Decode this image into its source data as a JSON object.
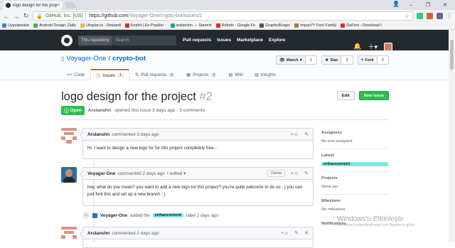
{
  "browser": {
    "tab_title": "logo design for the proje",
    "security_label": "GitHub, Inc. [US]",
    "url_host": "https://github.com",
    "url_path": "/Voyager-One/crypto-bot/issues/2",
    "bookmarks": [
      "Uygulamalar",
      "Android Design, Daily",
      "Utopian.io - Rewardi",
      "Keşfet | En Popüler -",
      "arslanshn — Steemit",
      "Roboto - Google Fo",
      "GraphicBurger",
      "Impact™ Font Family",
      "DaFont - Download f"
    ],
    "bookmark_colors": [
      "#4a7fd4",
      "#4caf50",
      "#e8b84a",
      "#d93025",
      "#1aa3a3",
      "#d93025",
      "#555555",
      "#9c7a52",
      "#d93025"
    ]
  },
  "github": {
    "search_scope": "This repository",
    "search_placeholder": "Search",
    "nav": [
      "Pull requests",
      "Issues",
      "Marketplace",
      "Explore"
    ],
    "icons": [
      "bell-icon",
      "plus-icon"
    ]
  },
  "repo": {
    "owner": "Voyager-One",
    "slash": "/",
    "name": "crypto-bot",
    "watch_label": "Watch",
    "watch_count": "1",
    "star_label": "Star",
    "star_count": "2",
    "fork_label": "Fork",
    "fork_count": "2",
    "tabs": [
      {
        "label": "Code",
        "count": ""
      },
      {
        "label": "Issues",
        "count": "1"
      },
      {
        "label": "Pull requests",
        "count": "0"
      },
      {
        "label": "Projects",
        "count": "0"
      },
      {
        "label": "Wiki",
        "count": ""
      },
      {
        "label": "Insights",
        "count": ""
      }
    ]
  },
  "issue": {
    "title": "logo design for the project",
    "number": "#2",
    "edit_label": "Edit",
    "new_issue_label": "New issue",
    "state": "Open",
    "author": "Arslanshn",
    "meta_text": "opened this issue 3 days ago · 3 comments"
  },
  "comments": [
    {
      "author": "Arslanshn",
      "when": "commented 3 days ago",
      "edited": "",
      "badge": "",
      "body": "Hi. I want to design a new logo for for this project completely free..."
    },
    {
      "author": "Voyager-One",
      "when": "commented 2 days ago",
      "edited": "• edited ▾",
      "badge": "Owner",
      "body": "hey, what do you mean? you want to add a new logo for this project? you're quite welcome to do so : ) you can just fork this and set up a new branch : )"
    },
    {
      "author": "Arslanshn",
      "when": "commented 2 days ago",
      "edited": "",
      "badge": "",
      "body": ""
    }
  ],
  "event": {
    "actor": "Voyager-One",
    "action": "added the",
    "label": "enhancement",
    "suffix": "label 2 days ago"
  },
  "sidebar": {
    "assignees_h": "Assignees",
    "assignees_v": "No one assigned",
    "labels_h": "Labels",
    "label": "enhancement",
    "label_color": "#7ee8e3",
    "projects_h": "Projects",
    "projects_v": "None yet",
    "milestone_h": "Milestone",
    "milestone_v": "No milestone",
    "notifications_h": "Notifications"
  },
  "watermark": {
    "line1": "Windows'u Etkinleştir",
    "line2": "Windows'u etkinleştirmek için Ayarlar'a gidin."
  }
}
